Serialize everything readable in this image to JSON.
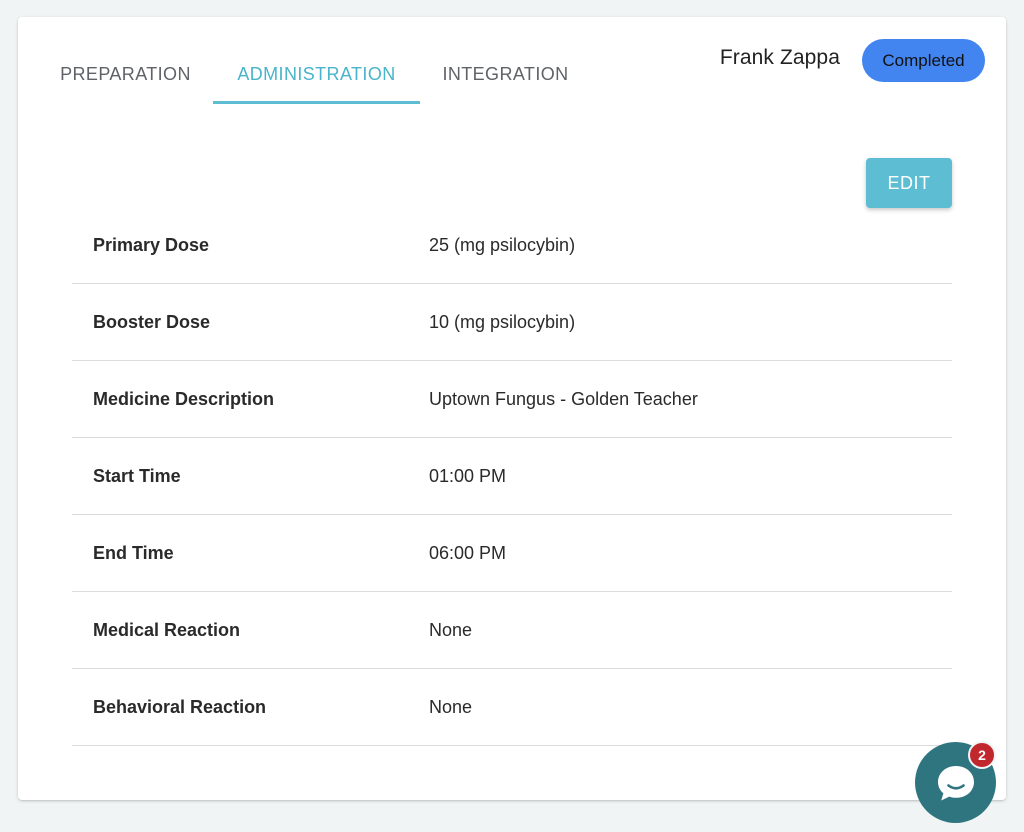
{
  "tabs": [
    {
      "label": "PREPARATION",
      "active": false
    },
    {
      "label": "ADMINISTRATION",
      "active": true
    },
    {
      "label": "INTEGRATION",
      "active": false
    }
  ],
  "header": {
    "user_name": "Frank Zappa",
    "status": "Completed"
  },
  "actions": {
    "edit_label": "EDIT"
  },
  "details": [
    {
      "label": "Primary Dose",
      "value": "25 (mg psilocybin)"
    },
    {
      "label": "Booster Dose",
      "value": "10 (mg psilocybin)"
    },
    {
      "label": "Medicine Description",
      "value": "Uptown Fungus - Golden Teacher"
    },
    {
      "label": "Start Time",
      "value": "01:00 PM"
    },
    {
      "label": "End Time",
      "value": "06:00 PM"
    },
    {
      "label": "Medical Reaction",
      "value": "None"
    },
    {
      "label": "Behavioral Reaction",
      "value": "None"
    }
  ],
  "chat": {
    "icon": "chat-bubble-icon",
    "unread_count": "2"
  },
  "colors": {
    "accent": "#5dbdd3",
    "status_badge": "#4285f0",
    "chat_button": "#2f7580",
    "notification": "#c0282d"
  }
}
